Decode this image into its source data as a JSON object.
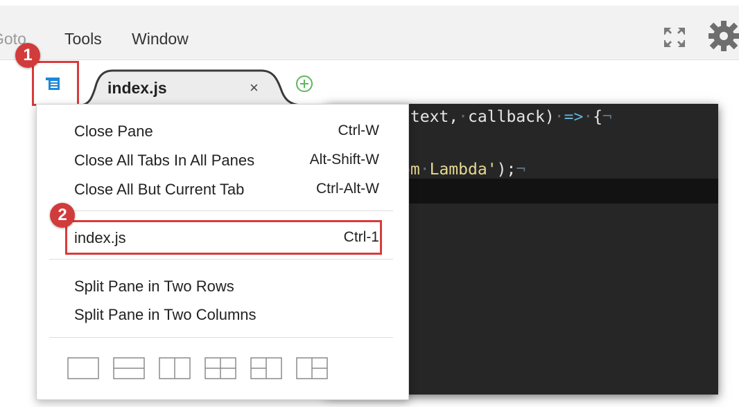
{
  "menubar": {
    "items": [
      "Goto",
      "Tools",
      "Window"
    ]
  },
  "tabs": [
    {
      "title": "index.js",
      "close_glyph": "×"
    }
  ],
  "editor": {
    "line1": {
      "text": "ntext, callback) => {",
      "eol": "¬"
    },
    "line2": {
      "text": "om Lambda');",
      "eol": "¬"
    }
  },
  "dropdown": {
    "items": [
      {
        "label": "Close Pane",
        "shortcut": "Ctrl-W"
      },
      {
        "label": "Close All Tabs In All Panes",
        "shortcut": "Alt-Shift-W"
      },
      {
        "label": "Close All But Current Tab",
        "shortcut": "Ctrl-Alt-W"
      },
      {
        "label": "index.js",
        "shortcut": "Ctrl-1"
      },
      {
        "label": "Split Pane in Two Rows",
        "shortcut": ""
      },
      {
        "label": "Split Pane in Two Columns",
        "shortcut": ""
      }
    ],
    "layout_icons": [
      "single-pane-icon",
      "two-rows-icon",
      "two-columns-icon",
      "grid-four-icon",
      "three-panes-left-icon",
      "three-panes-right-icon"
    ]
  },
  "callouts": [
    "1",
    "2"
  ],
  "icons": {
    "pane_menu": "pane-menu-icon",
    "add_tab": "add-tab-icon",
    "fullscreen": "fullscreen-icon",
    "settings": "gear-icon"
  },
  "colors": {
    "callout": "#d23b3b",
    "editor_bg": "#262626",
    "accent_blue": "#1e88d8",
    "add_green": "#5cb85c"
  }
}
